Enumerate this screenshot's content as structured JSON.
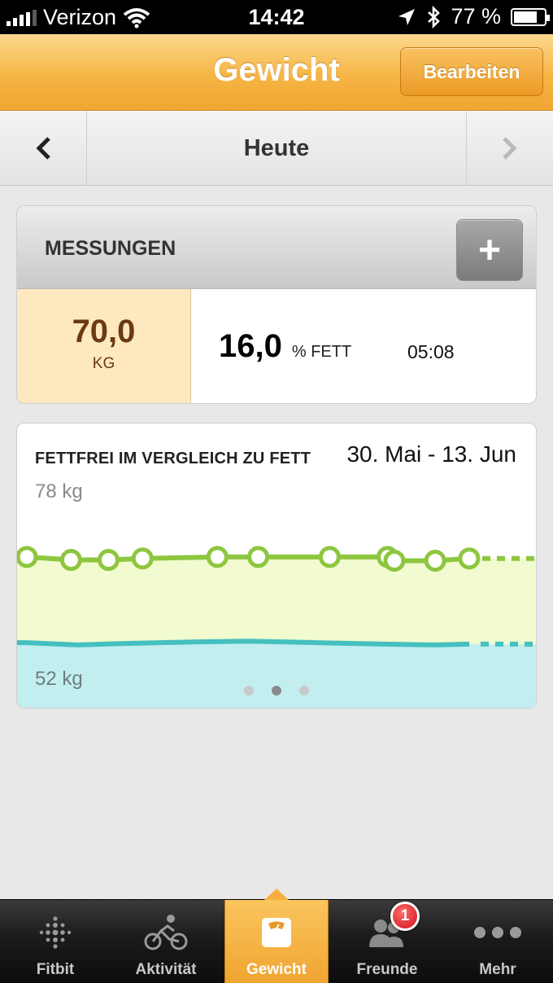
{
  "status": {
    "carrier": "Verizon",
    "time": "14:42",
    "battery": "77 %",
    "battery_level": 0.77
  },
  "navbar": {
    "title": "Gewicht",
    "edit_label": "Bearbeiten"
  },
  "datenav": {
    "label": "Heute",
    "prev_icon": "chevron-left-icon",
    "next_icon": "chevron-right-icon"
  },
  "measurements": {
    "title": "MESSUNGEN",
    "add_label": "+",
    "weight_value": "70,0",
    "weight_unit": "KG",
    "fat_value": "16,0",
    "fat_unit": "% FETT",
    "time": "05:08"
  },
  "chart": {
    "title": "FETTFREI IM VERGLEICH ZU FETT",
    "range": "30. Mai - 13. Jun",
    "ymax_label": "78 kg",
    "ymin_label": "52 kg",
    "page_count": 3,
    "active_page": 1
  },
  "chart_data": {
    "type": "area",
    "title": "FETTFREI IM VERGLEICH ZU FETT",
    "ylim": [
      52,
      78
    ],
    "y_ticks": [
      "78 kg",
      "52 kg"
    ],
    "x_range_label": "30. Mai - 13. Jun",
    "series": [
      {
        "x": [
          0,
          1.3,
          2.4,
          3.4,
          5.6,
          6.8,
          8.9,
          10.6,
          10.8,
          12.0,
          13.0
        ],
        "values": [
          70.0,
          69.6,
          69.6,
          69.8,
          70.0,
          70.0,
          70.0,
          70.0,
          69.5,
          69.5,
          69.8
        ],
        "color": "#8dc63f",
        "fill": "#f1fbcf"
      },
      {
        "x": [
          0,
          1.5,
          3.0,
          5.0,
          6.5,
          8.5,
          10.5,
          12.0,
          13.0
        ],
        "values": [
          58.6,
          58.3,
          58.5,
          58.7,
          58.8,
          58.6,
          58.4,
          58.3,
          58.4
        ],
        "color": "#45bfbf",
        "fill": "#c3eef0"
      }
    ],
    "colors": {
      "lean": "#8dc63f",
      "fat": "#45bfbf"
    },
    "grid": false,
    "legend": "none"
  },
  "tabs": [
    {
      "label": "Fitbit",
      "icon": "fitbit-logo-icon",
      "active": false
    },
    {
      "label": "Aktivität",
      "icon": "bicycle-icon",
      "active": false
    },
    {
      "label": "Gewicht",
      "icon": "scale-icon",
      "active": true
    },
    {
      "label": "Freunde",
      "icon": "friends-icon",
      "active": false,
      "badge": "1"
    },
    {
      "label": "Mehr",
      "icon": "more-icon",
      "active": false
    }
  ]
}
